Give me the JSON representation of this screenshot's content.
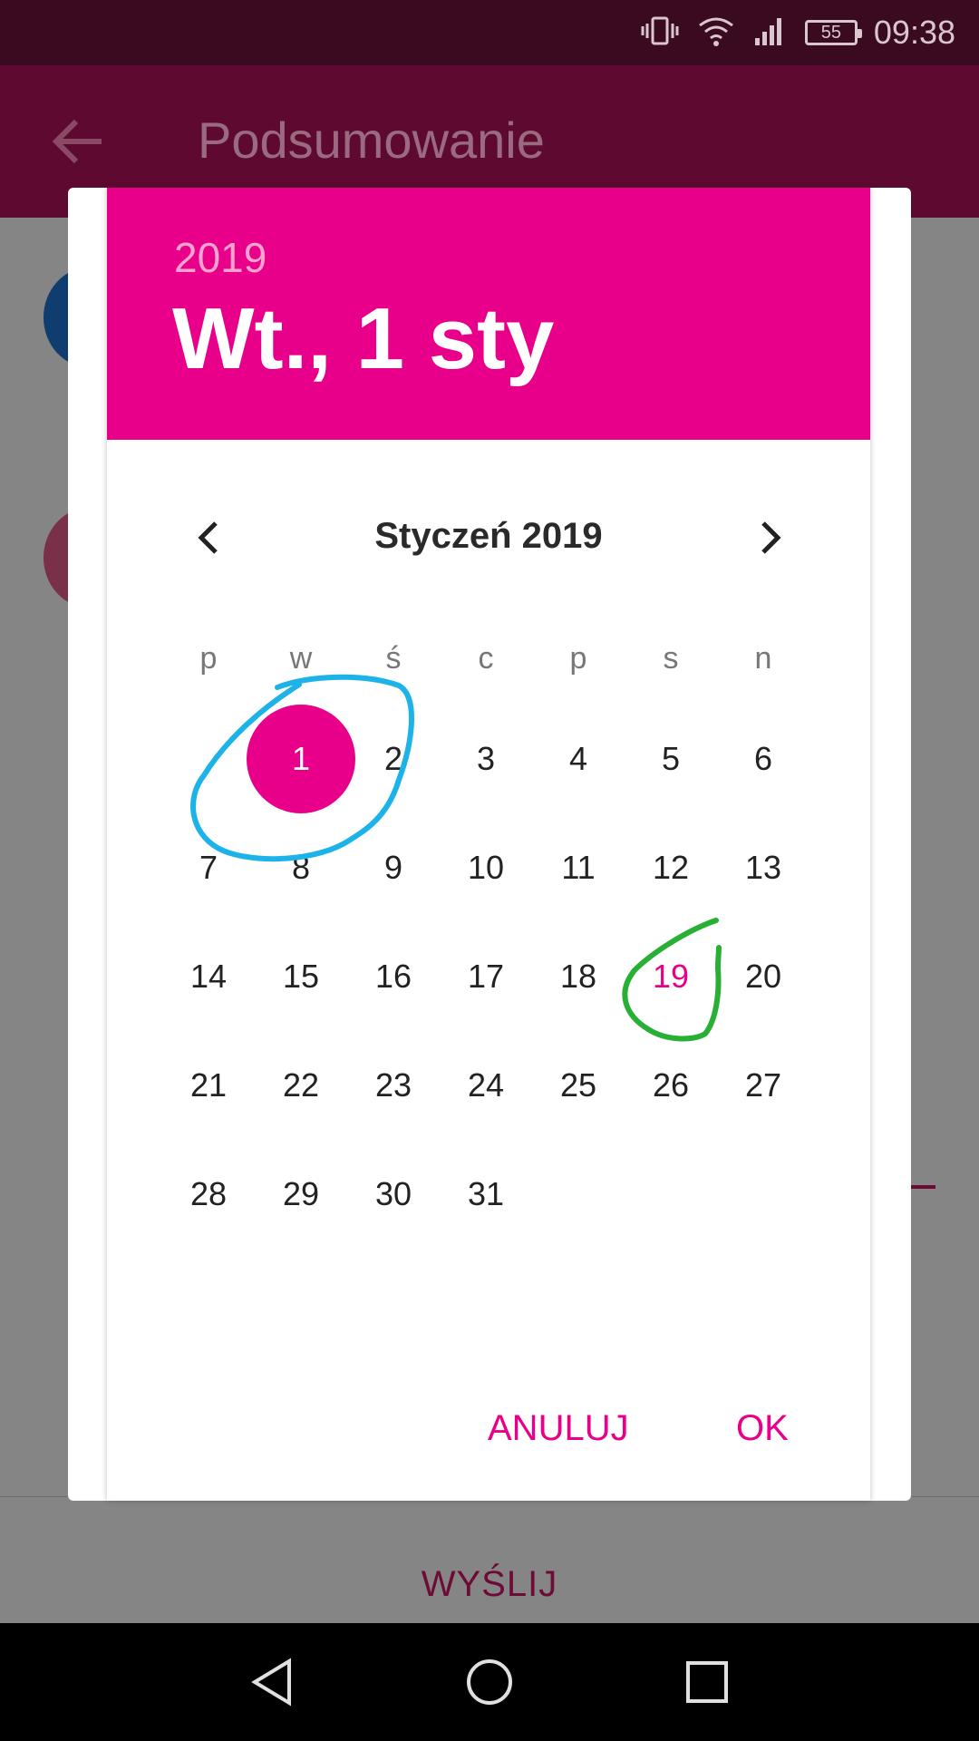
{
  "status_bar": {
    "battery": "55",
    "time": "09:38"
  },
  "app_bar": {
    "title": "Podsumowanie",
    "back_icon": "arrow-back-icon"
  },
  "background": {
    "send_button": "WYŚLIJ"
  },
  "dialog": {
    "year": "2019",
    "selected_date": "Wt., 1 sty",
    "month_label": "Styczeń 2019",
    "weekdays": [
      "p",
      "w",
      "ś",
      "c",
      "p",
      "s",
      "n"
    ],
    "selected_day": "1",
    "today_day": "19",
    "cancel_label": "ANULUJ",
    "ok_label": "OK",
    "days": [
      "1",
      "2",
      "3",
      "4",
      "5",
      "6",
      "7",
      "8",
      "9",
      "10",
      "11",
      "12",
      "13",
      "14",
      "15",
      "16",
      "17",
      "18",
      "19",
      "20",
      "21",
      "22",
      "23",
      "24",
      "25",
      "26",
      "27",
      "28",
      "29",
      "30",
      "31"
    ]
  },
  "colors": {
    "accent": "#e9008a",
    "status_bar": "#3a0a20",
    "app_bar_dimmed": "#5e0a30",
    "annotation_blue": "#1eb3e8",
    "annotation_green": "#28b034"
  }
}
